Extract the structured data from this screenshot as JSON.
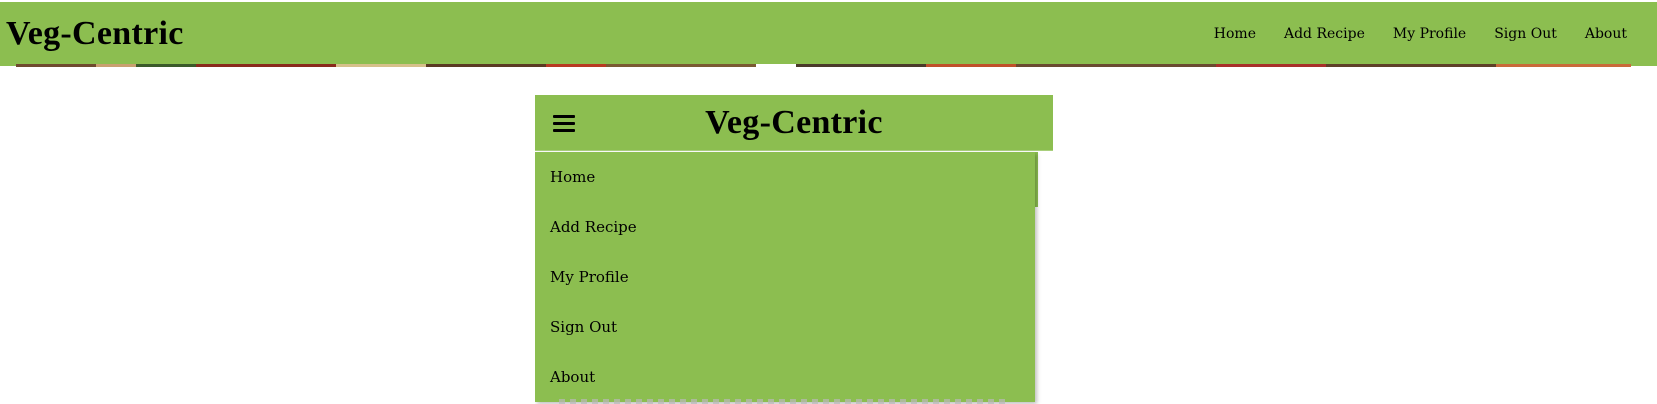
{
  "brand": "Veg-Centric",
  "desktop_nav": {
    "items": [
      {
        "label": "Home"
      },
      {
        "label": "Add Recipe"
      },
      {
        "label": "My Profile"
      },
      {
        "label": "Sign Out"
      },
      {
        "label": "About"
      }
    ]
  },
  "mobile": {
    "brand": "Veg-Centric",
    "menu_icon": "hamburger-icon",
    "menu_items": [
      {
        "label": "Home"
      },
      {
        "label": "Add Recipe"
      },
      {
        "label": "My Profile"
      },
      {
        "label": "Sign Out"
      },
      {
        "label": "About"
      }
    ]
  },
  "colors": {
    "header_green": "#8cbe50",
    "text": "#000000",
    "background": "#ffffff"
  }
}
